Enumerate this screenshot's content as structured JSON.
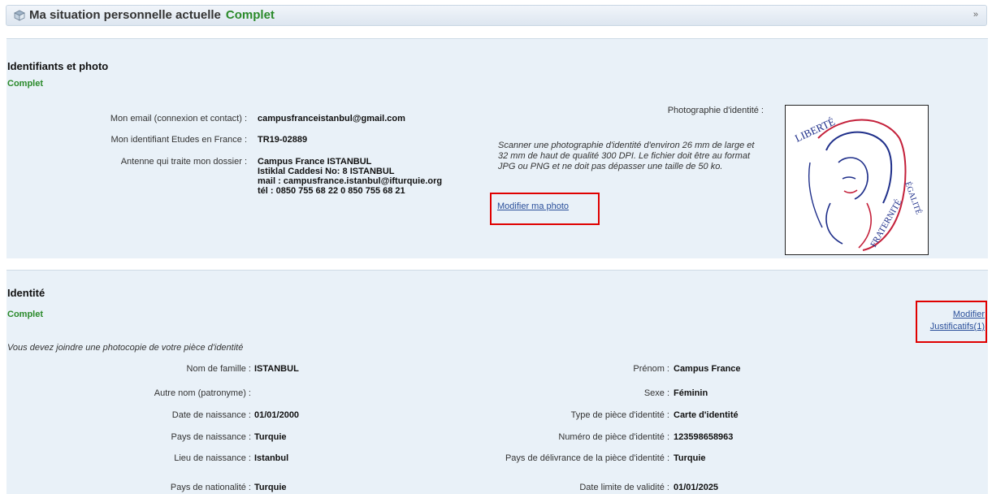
{
  "header": {
    "title": "Ma situation personnelle actuelle",
    "status": "Complet",
    "collapse_icon": "»"
  },
  "identifiants": {
    "title": "Identifiants et photo",
    "status": "Complet",
    "email_label": "Mon email (connexion et contact) :",
    "email_value": "campusfranceistanbul@gmail.com",
    "id_label": "Mon identifiant Etudes en France :",
    "id_value": "TR19-02889",
    "antenne_label": "Antenne qui traite mon dossier :",
    "antenne_lines": [
      "Campus France ISTANBUL",
      "Istiklal Caddesi No: 8 ISTANBUL",
      "mail : campusfrance.istanbul@ifturquie.org",
      "tél : 0850 755 68 22 0 850 755 68 21"
    ],
    "photo_label": "Photographie d'identité :",
    "photo_note": "Scanner une photographie d'identité d'environ 26 mm de large et 32 mm de haut de qualité 300 DPI. Le fichier doit être au format JPG ou PNG et ne doit pas dépasser une taille de 50 ko.",
    "modify_photo": "Modifier ma photo",
    "photo_words": {
      "w1": "LIBERTÉ",
      "w2": "ÉGALITÉ",
      "w3": "FRATERNITÉ"
    }
  },
  "identite": {
    "title": "Identité",
    "status": "Complet",
    "modify": "Modifier",
    "justificatifs": "Justificatifs(1)",
    "notice": "Vous devez joindre une photocopie de votre pièce d'identité",
    "left": [
      {
        "label": "Nom de famille :",
        "value": "ISTANBUL"
      },
      {
        "label": "Autre nom (patronyme) :",
        "value": ""
      },
      {
        "label": "Date de naissance :",
        "value": "01/01/2000"
      },
      {
        "label": "Pays de naissance :",
        "value": "Turquie"
      },
      {
        "label": "Lieu de naissance :",
        "value": "Istanbul"
      },
      {
        "label": "Pays de nationalité :",
        "value": "Turquie"
      }
    ],
    "right": [
      {
        "label": "Prénom :",
        "value": "Campus France"
      },
      {
        "label": "Sexe :",
        "value": "Féminin"
      },
      {
        "label": "Type de pièce d'identité :",
        "value": "Carte d'identité"
      },
      {
        "label": "Numéro de pièce d'identité :",
        "value": "123598658963"
      },
      {
        "label": "Pays de délivrance de la pièce d'identité :",
        "value": "Turquie"
      },
      {
        "label": "Date limite de validité :",
        "value": "01/01/2025"
      }
    ]
  }
}
